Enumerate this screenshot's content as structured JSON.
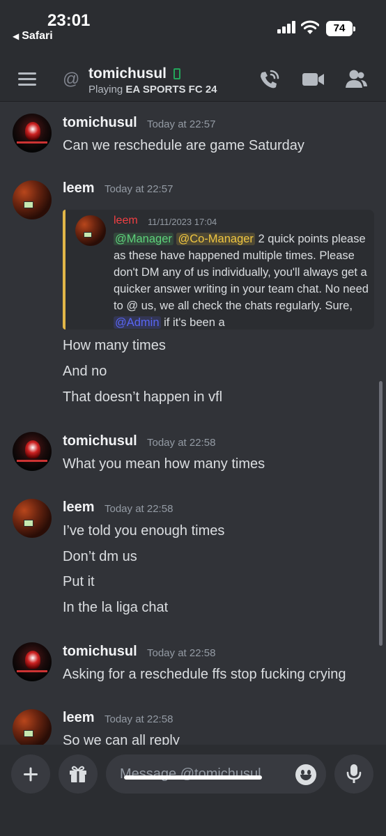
{
  "status_bar": {
    "time": "23:01",
    "back_app": "Safari",
    "battery": "74"
  },
  "header": {
    "name": "tomichusul",
    "activity_prefix": "Playing",
    "activity_game": "EA SPORTS FC 24"
  },
  "messages": [
    {
      "author": "tomichusul",
      "timestamp": "Today at 22:57",
      "lines": [
        "Can we reschedule are game Saturday"
      ]
    },
    {
      "author": "leem",
      "timestamp": "Today at 22:57",
      "quote": {
        "author": "leem",
        "date": "11/11/2023 17:04",
        "mention1": "@Manager",
        "mention2": "@Co-Manager",
        "text1": " 2 quick points please as these have happened multiple times. Please don't DM any of us individually, you'll always get a quicker answer writing in your team chat. No need to @ us, we all check the chats regularly. Sure, ",
        "mention3": "@Admin",
        "text2": " if it's been a"
      },
      "lines": [
        "How many times",
        "And no",
        "That doesn’t happen in vfl"
      ]
    },
    {
      "author": "tomichusul",
      "timestamp": "Today at 22:58",
      "lines": [
        "What you mean how many times"
      ]
    },
    {
      "author": "leem",
      "timestamp": "Today at 22:58",
      "lines": [
        "I’ve told you enough times",
        "Don’t dm us",
        "Put it",
        "In the la liga chat"
      ]
    },
    {
      "author": "tomichusul",
      "timestamp": "Today at 22:58",
      "lines": [
        "Asking for a reschedule ffs stop fucking crying"
      ]
    },
    {
      "author": "leem",
      "timestamp": "Today at 22:58",
      "lines": [
        "So we can all reply"
      ]
    }
  ],
  "composer": {
    "placeholder": "Message @tomichusul"
  },
  "colors": {
    "background": "#313338",
    "header": "#2b2d31",
    "online_green": "#23a55a",
    "quote_bar": "#e1b648"
  },
  "icons": [
    "hamburger-icon",
    "at-icon",
    "mobile-icon",
    "call-icon",
    "video-icon",
    "members-icon",
    "plus-icon",
    "gift-icon",
    "emoji-icon",
    "mic-icon"
  ]
}
